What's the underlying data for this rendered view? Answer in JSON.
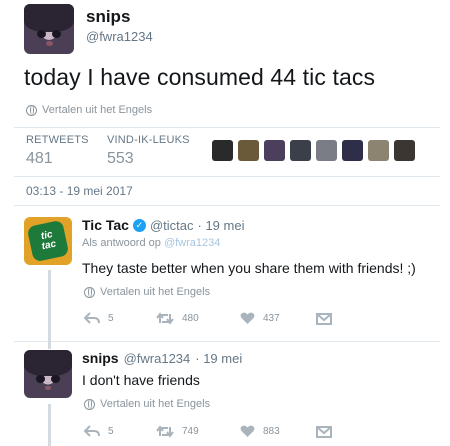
{
  "main_tweet": {
    "display_name": "snips",
    "handle": "@fwra1234",
    "text": "today I have consumed 44 tic tacs",
    "translate": "Vertalen uit het Engels",
    "retweets_label": "RETWEETS",
    "retweets_value": "481",
    "likes_label": "VIND-IK-LEUKS",
    "likes_value": "553",
    "timestamp": "03:13 - 19 mei 2017"
  },
  "reply_1": {
    "display_name": "Tic Tac",
    "handle": "@tictac",
    "date": "· 19 mei",
    "reply_to_label": "Als antwoord op",
    "reply_to_handle": "@fwra1234",
    "text": "They taste better when you share them with friends! ;)",
    "translate": "Vertalen uit het Engels",
    "replies": "5",
    "retweets": "480",
    "likes": "437",
    "logo_text_1": "tic",
    "logo_text_2": "tac"
  },
  "reply_2": {
    "display_name": "snips",
    "handle": "@fwra1234",
    "date": "· 19 mei",
    "text": "I don't have friends",
    "translate": "Vertalen uit het Engels",
    "replies": "5",
    "retweets": "749",
    "likes": "883"
  },
  "colors": {
    "liker_avatars": [
      "#2a2a2a",
      "#6b5a3a",
      "#4c3f5e",
      "#3a3f4a",
      "#7a7d86",
      "#2e2e48",
      "#8c8470",
      "#3b3631"
    ]
  }
}
